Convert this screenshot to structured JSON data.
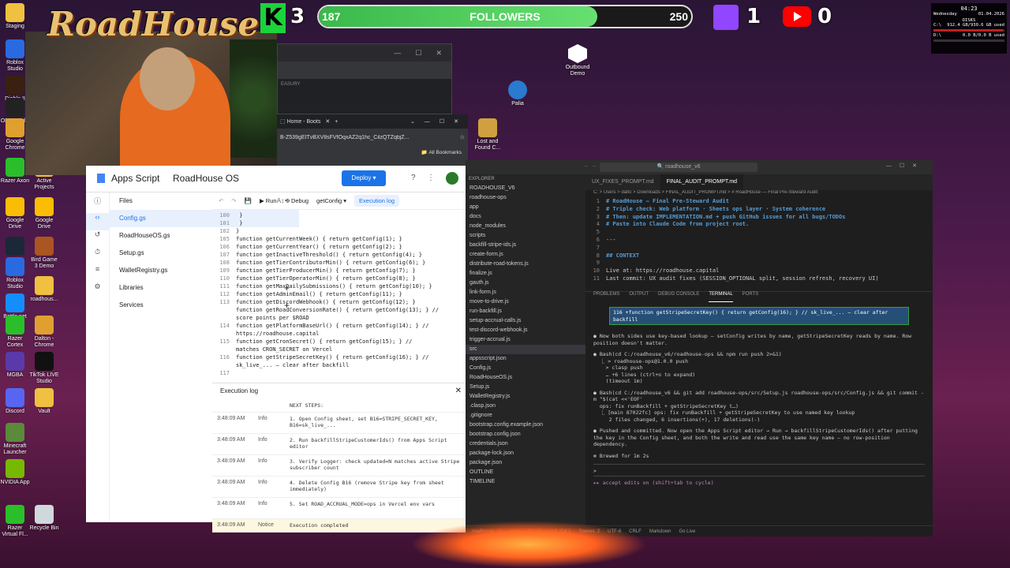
{
  "desktop_icons_left": [
    {
      "label": "Staging",
      "color": "#f0c040"
    },
    {
      "label": "Roblox Studio",
      "color": "#2a6ae0"
    },
    {
      "label": "Diablo II",
      "color": "#3a2010"
    },
    {
      "label": "OBS Studio",
      "color": "#222"
    },
    {
      "label": "Google Chrome",
      "color": "#e0a030"
    },
    {
      "label": "Razer Axon",
      "color": "#2abf2a"
    },
    {
      "label": "Google Drive",
      "color": "#fbbc04"
    },
    {
      "label": "Steam",
      "color": "#1b2838"
    },
    {
      "label": "Roblox Studio",
      "color": "#2a6ae0"
    },
    {
      "label": "Battle.net",
      "color": "#148eff"
    },
    {
      "label": "Razer Cortex",
      "color": "#2abf2a"
    },
    {
      "label": "MGBA",
      "color": "#5a3aaa"
    },
    {
      "label": "Discord",
      "color": "#5865f2"
    },
    {
      "label": "Minecraft Launcher",
      "color": "#5a8a3a"
    },
    {
      "label": "NVIDIA App",
      "color": "#76b900"
    },
    {
      "label": "Razer Virtual Fl...",
      "color": "#2abf2a"
    }
  ],
  "desktop_icons_col2": [
    {
      "label": "Active Projects",
      "color": "#f0c040"
    },
    {
      "label": "Google Drive",
      "color": "#fbbc04"
    },
    {
      "label": "Bird Game 3 Demo",
      "color": "#aa5522"
    },
    {
      "label": "roadhous...",
      "color": "#f0c040"
    },
    {
      "label": "Dalton - Chrome",
      "color": "#e0a030"
    },
    {
      "label": "TikTok LIVE Studio",
      "color": "#111"
    },
    {
      "label": "Vault",
      "color": "#f0c040"
    },
    {
      "label": "Recycle Bin",
      "color": "#cfd8dc"
    }
  ],
  "desktop_icons_mid": [
    {
      "label": "Outbound Demo"
    },
    {
      "label": "Palia"
    },
    {
      "label": "Lost and Found C..."
    }
  ],
  "overlay": {
    "brand": "RoadHouse",
    "kick_letter": "K",
    "kick_count": "3",
    "followers_current": "187",
    "followers_label": "FOLLOWERS",
    "followers_goal": "250",
    "followers_progress": 0.748,
    "twitch_count": "1",
    "youtube_count": "0"
  },
  "sys_widget": {
    "time": "04:23",
    "day": "Wednesday",
    "date": "01.04.2026",
    "title": "DISKS",
    "disks": [
      {
        "name": "C:\\",
        "info": "912.4 GB/930.6 GB used",
        "used": 0.98
      },
      {
        "name": "D:\\",
        "info": "0.0 B/0.0 B used",
        "used": 0.0
      }
    ]
  },
  "browser": {
    "url": "B-Z539gEITvBXV8sFVfOqxAZ2q1hc_CilzQTZqbjZ...",
    "tab_label": "Home - Boots",
    "bookmarks": "All Bookmarks",
    "partial_text": "EASURY"
  },
  "apps_script": {
    "app_name": "Apps Script",
    "project": "RoadHouse OS",
    "deploy_label": "Deploy",
    "files_label": "Files",
    "files": [
      "Config.gs",
      "RoadHouseOS.gs",
      "Setup.gs",
      "WalletRegistry.gs"
    ],
    "libraries_label": "Libraries",
    "services_label": "Services",
    "run_label": "Run",
    "debug_label": "Debug",
    "function_select": "getConfig",
    "exec_log_button": "Execution log",
    "code": [
      {
        "n": "100",
        "t": "  }"
      },
      {
        "n": "101",
        "t": "  }"
      },
      {
        "n": "102",
        "t": "}"
      },
      {
        "n": "105",
        "t": "function getCurrentWeek()       { return getConfig(1); }"
      },
      {
        "n": "106",
        "t": "function getCurrentYear()       { return getConfig(2); }"
      },
      {
        "n": "107",
        "t": "function getInactiveThreshold() { return getConfig(4); }"
      },
      {
        "n": "108",
        "t": "function getTierContributorMin() { return getConfig(6); }"
      },
      {
        "n": "109",
        "t": "function getTierProducerMin()   { return getConfig(7); }"
      },
      {
        "n": "110",
        "t": "function getTierOperatorMin()   { return getConfig(8); }"
      },
      {
        "n": "111",
        "t": "function getMaxDailySubmissions() { return getConfig(10); }"
      },
      {
        "n": "112",
        "t": "function getAdminEmail()        { return getConfig(11); }"
      },
      {
        "n": "113",
        "t": "function getDiscordWebhook()    { return getConfig(12); }"
      },
      {
        "n": "",
        "t": "function getRoadConversionRate() { return getConfig(13); } //"
      },
      {
        "n": "",
        "t": "score points per $ROAD"
      },
      {
        "n": "114",
        "t": "function getPlatformBaseUrl()   { return getConfig(14); } //"
      },
      {
        "n": "",
        "t": "https://roadhouse.capital"
      },
      {
        "n": "115",
        "t": "function getCronSecret()        { return getConfig(15); } //"
      },
      {
        "n": "",
        "t": "matches CRON_SECRET on Vercel"
      },
      {
        "n": "116",
        "t": "function getStripeSecretKey()   { return getConfig(16); } //"
      },
      {
        "n": "",
        "t": "sk_live_... — clear after backfill"
      },
      {
        "n": "117",
        "t": ""
      }
    ],
    "log_title": "Execution log",
    "log_rows": [
      {
        "time": "",
        "level": "",
        "msg": "NEXT STEPS:"
      },
      {
        "time": "3:48:09 AM",
        "level": "Info",
        "msg": "1. Open Config sheet, set B16=STRIPE_SECRET_KEY, B16=sk_live_..."
      },
      {
        "time": "3:48:09 AM",
        "level": "Info",
        "msg": "2. Run backfillStripeCustomerIds() from Apps Script editor"
      },
      {
        "time": "3:48:09 AM",
        "level": "Info",
        "msg": "3. Verify Logger: check updated=N matches active Stripe subscriber count"
      },
      {
        "time": "3:48:09 AM",
        "level": "Info",
        "msg": "4. Delete Config B16 (remove Stripe key from sheet immediately)"
      },
      {
        "time": "3:48:09 AM",
        "level": "Info",
        "msg": "5. Set ROAD_ACCRUAL_MODE=ops in Vercel env vars"
      },
      {
        "time": "3:48:09 AM",
        "level": "Notice",
        "msg": "Execution completed"
      }
    ]
  },
  "vscode": {
    "search": "roadhouse_v6",
    "explorer_title": "EXPLORER",
    "explorer_items": [
      "ROADHOUSE_V6",
      "roadhouse-ops",
      "app",
      "docs",
      "node_modules",
      "scripts",
      "backfill-stripe-ids.js",
      "create-form.js",
      "distribute-road-tokens.js",
      "finalize.js",
      "gauth.js",
      "link-form.js",
      "move-to-drive.js",
      "run-backfill.js",
      "setup-accrual-calls.js",
      "test-discord-webhook.js",
      "trigger-accrual.js",
      "src",
      "appsscript.json",
      "Config.js",
      "RoadHouseOS.js",
      "Setup.js",
      "WalletRegistry.js",
      ".clasp.json",
      ".gitignore",
      "bootstrap.config.example.json",
      "bootstrap.config.json",
      "credentials.json",
      "package-lock.json",
      "package.json",
      "OUTLINE",
      "TIMELINE"
    ],
    "tabs": [
      {
        "label": "UX_FIXES_PROMPT.md",
        "active": false
      },
      {
        "label": "FINAL_AUDIT_PROMPT.md",
        "active": true
      }
    ],
    "breadcrumb": "C: > Users > dalto > Downloads > FINAL_AUDIT_PROMPT.md > # RoadHouse — Final Pre-Steward Audit",
    "editor_lines": [
      {
        "n": "1",
        "t": "# RoadHouse — Final Pre-Steward Audit",
        "h": true
      },
      {
        "n": "2",
        "t": "# Triple check: Web platform · Sheets ops layer · System coherence",
        "h": true
      },
      {
        "n": "3",
        "t": "# Then: update IMPLEMENTATION.md + push GitHub issues for all bugs/TODOs",
        "h": true
      },
      {
        "n": "4",
        "t": "# Paste into Claude Code from project root.",
        "h": true
      },
      {
        "n": "5",
        "t": "",
        "h": false
      },
      {
        "n": "6",
        "t": "---",
        "h": false
      },
      {
        "n": "7",
        "t": "",
        "h": false
      },
      {
        "n": "8",
        "t": "## CONTEXT",
        "h": true
      },
      {
        "n": "9",
        "t": "",
        "h": false
      },
      {
        "n": "10",
        "t": "Live at: https://roadhouse.capital",
        "h": false
      },
      {
        "n": "11",
        "t": "Last commit: UX audit fixes (SESSION_OPTIONAL split, session refresh, recovery UI)",
        "h": false
      }
    ],
    "panel_tabs": [
      "PROBLEMS",
      "OUTPUT",
      "DEBUG CONSOLE",
      "TERMINAL",
      "PORTS"
    ],
    "panel_active": "TERMINAL",
    "terminal_highlight": "116 +function getStripeSecretKey()    { return getConfig(16); } // sk_live_... — clear after backfill",
    "terminal": [
      "● Now both sides use key-based lookup — setConfig writes by name, getStripeSecretKey reads by name. Row position doesn't matter.",
      "● Bash(cd C:/roadhouse_v6/roadhouse-ops && npm run push 2>&1)\n  ⎿ > roadhouse-ops@1.0.0 push\n    > clasp push\n    … +6 lines (ctrl+o to expand)\n    (timeout 1m)",
      "● Bash(cd C:/roadhouse_v6 && git add roadhouse-ops/src/Setup.js roadhouse-ops/src/Config.js && git commit -m \"$(cat <<'EOF'\n  ops: fix runBackfill + getStripeSecretKey t…)\n  ⎿ [main 87022fc] ops: fix runBackfill + getStripeSecretKey to use named key lookup\n     2 files changed, 6 insertions(+), 17 deletions(-)",
      "● Pushed and committed. Now open the Apps Script editor → Run → backfillStripeCustomerIds() after putting the key in the Config sheet, and both the write and read use the same key name — no row-position dependency.",
      "✻ Brewed for 1m 2s"
    ],
    "prompt": ">",
    "accept_hint": "▸▸ accept edits on (shift+tab to cycle)",
    "status": [
      "roadhouse_v6",
      "main",
      "0 ⚠ 0",
      "Ln 1, Col 1",
      "Spaces: 2",
      "UTF-8",
      "CRLF",
      "Markdown",
      "Go Live"
    ]
  }
}
